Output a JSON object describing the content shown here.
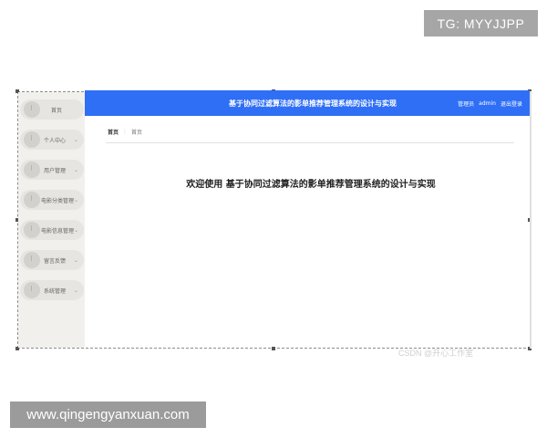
{
  "watermarks": {
    "tag": "TG: MYYJJPP",
    "site": "www.qingengyanxuan.com",
    "csdn": "CSDN @开心工作室"
  },
  "header": {
    "title": "基于协同过滤算法的影单推荐管理系统的设计与实现",
    "role": "管理员",
    "username": "admin",
    "logout": "退出登录",
    "color": "#2f6ff6"
  },
  "sidebar": {
    "items": [
      {
        "label": "首页",
        "icon": "clock-icon",
        "has_chevron": false
      },
      {
        "label": "个人中心",
        "icon": "clock-icon",
        "has_chevron": true
      },
      {
        "label": "用户管理",
        "icon": "clock-icon",
        "has_chevron": true
      },
      {
        "label": "电影分类管理",
        "icon": "clock-icon",
        "has_chevron": true
      },
      {
        "label": "电影信息管理",
        "icon": "clock-icon",
        "has_chevron": true
      },
      {
        "label": "留言反馈",
        "icon": "clock-icon",
        "has_chevron": true
      },
      {
        "label": "系统管理",
        "icon": "clock-icon",
        "has_chevron": true
      }
    ]
  },
  "breadcrumb": {
    "root": "首页",
    "current": "首页"
  },
  "main": {
    "welcome": "欢迎使用 基于协同过滤算法的影单推荐管理系统的设计与实现"
  }
}
